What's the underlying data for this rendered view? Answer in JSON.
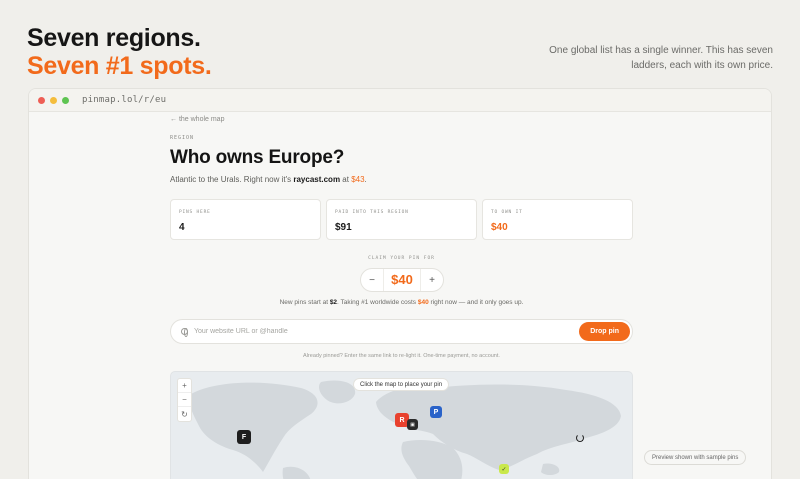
{
  "hero": {
    "line1": "Seven regions.",
    "line2": "Seven #1 spots.",
    "subtitle": "One global list has a single winner. This has seven ladders, each with its own price."
  },
  "window": {
    "url": "pinmap.lol/r/eu"
  },
  "back_link": "← the whole map",
  "eyebrow": "REGION",
  "headline": "Who owns Europe?",
  "description": {
    "prefix": "Atlantic to the Urals. Right now it's ",
    "owner": "raycast.com",
    "mid": " at ",
    "price": "$43",
    "suffix": "."
  },
  "stats": [
    {
      "label": "PINS HERE",
      "value": "4"
    },
    {
      "label": "PAID INTO THIS REGION",
      "value": "$91"
    },
    {
      "label": "TO OWN IT",
      "value": "$40"
    }
  ],
  "claim": {
    "label": "CLAIM YOUR PIN FOR",
    "minus": "−",
    "value": "$40",
    "plus": "+"
  },
  "fine_print": {
    "p1": "New pins start at ",
    "start": "$2",
    "p2": ". Taking #1 worldwide costs ",
    "cost": "$40",
    "p3": " right now — and it only goes up."
  },
  "input": {
    "placeholder": "Your website URL or @handle",
    "button": "Drop pin"
  },
  "hint": "Already pinned? Enter the same link to re-light it. One-time payment, no account.",
  "map": {
    "zoom_in": "+",
    "zoom_out": "−",
    "reset": "↻",
    "tip": "Click the map to place your pin",
    "preview": "Preview shown with sample pins",
    "pins": [
      {
        "name": "figma-pin",
        "letter": "F",
        "color": "#1e1e1e"
      },
      {
        "name": "raycast-pin",
        "letter": "R",
        "color": "#e8412e"
      },
      {
        "name": "sample-pin-dark",
        "letter": "▣",
        "color": "#2b2b2b"
      },
      {
        "name": "paypal-pin",
        "letter": "P",
        "color": "#2a63c9"
      },
      {
        "name": "sample-pin-green",
        "letter": "✓",
        "color": "#c9e84a"
      }
    ]
  },
  "colors": {
    "accent": "#f26a1b",
    "background": "#f0efeb"
  }
}
